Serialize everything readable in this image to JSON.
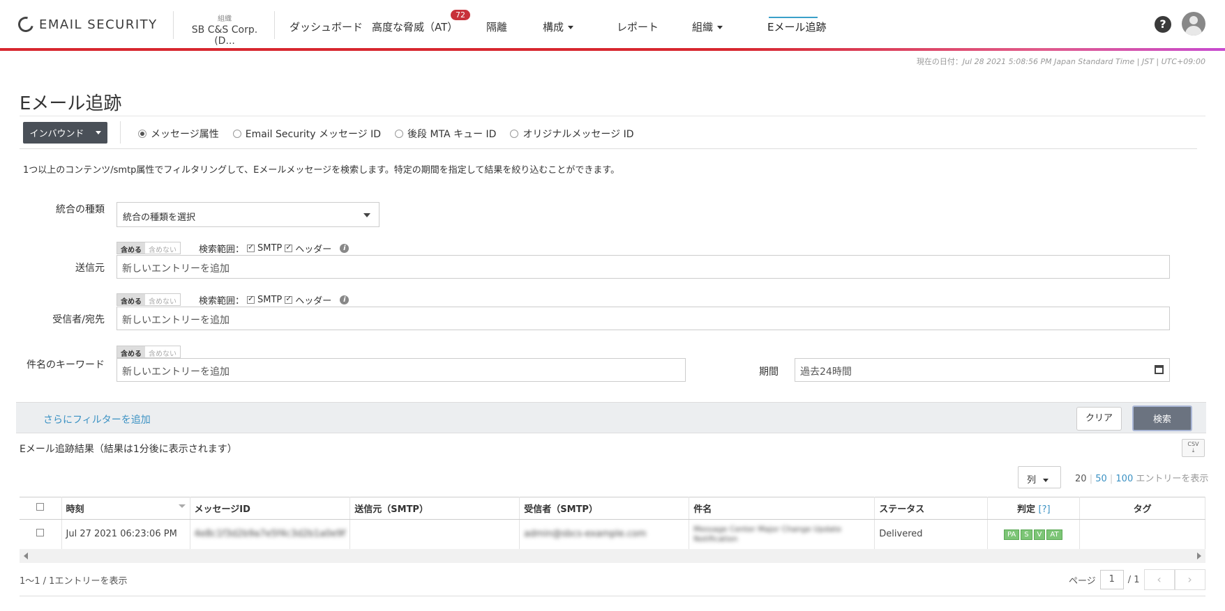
{
  "header": {
    "logo_text": "EMAIL SECURITY",
    "org_label": "組織",
    "org_name": "SB C&S Corp. (D...",
    "nav": {
      "dashboard": "ダッシュボード",
      "advanced_threats": "高度な脅威（AT）",
      "advanced_threats_badge": "72",
      "quarantine": "隔離",
      "config": "構成",
      "reports": "レポート",
      "organization": "組織",
      "email_trace": "Eメール追跡"
    },
    "help_icon": "question-circle-icon",
    "user_icon": "user-avatar-icon"
  },
  "datetime": {
    "label": "現在の日付：",
    "value": "Jul 28 2021 5:08:56 PM Japan Standard Time | JST | UTC+09:00"
  },
  "page_title": "Eメール追跡",
  "direction_button": "インバウンド",
  "search_modes": [
    {
      "label": "メッセージ属性",
      "selected": true
    },
    {
      "label": "Email Security メッセージ ID",
      "selected": false
    },
    {
      "label": "後段 MTA キュー ID",
      "selected": false
    },
    {
      "label": "オリジナルメッセージ ID",
      "selected": false
    }
  ],
  "description": "1つ以上のコンテンツ/smtp属性でフィルタリングして、Eメールメッセージを検索します。特定の期間を指定して結果を絞り込むことができます。",
  "form": {
    "integration_label": "統合の種類",
    "integration_placeholder": "統合の種類を選択",
    "include": "含める",
    "exclude": "含めない",
    "scope_label": "検索範囲：",
    "smtp": "SMTP",
    "header": "ヘッダー",
    "sender_label": "送信元",
    "recipient_label": "受信者/宛先",
    "subject_label": "件名のキーワード",
    "new_entry": "新しいエントリーを追加",
    "period_label": "期間",
    "period_value": "過去24時間"
  },
  "filter_bar": {
    "add_filter": "さらにフィルターを追加",
    "clear": "クリア",
    "search": "検索"
  },
  "results": {
    "title": "Eメール追跡結果（結果は1分後に表示されます）",
    "csv_label": "CSV",
    "columns_button": "列",
    "page_size_20": "20",
    "page_size_50": "50",
    "page_size_100": "100",
    "page_size_suffix": "エントリーを表示",
    "headers": [
      "時刻",
      "メッセージID",
      "送信元（SMTP）",
      "受信者（SMTP）",
      "件名",
      "ステータス",
      "判定",
      "タグ"
    ],
    "verdict_help": "[?]",
    "rows": [
      {
        "time": "Jul 27 2021 06:23:06 PM",
        "message_id": "4e8c1f3d2b9a7e5f4c3d2b1a0e9f",
        "sender": "",
        "recipient": "admin@sbcs-example.com",
        "subject": "Message Center Major Change Update Notification",
        "status": "Delivered",
        "verdicts": [
          "PA",
          "S",
          "V",
          "AT"
        ],
        "tag": ""
      }
    ],
    "footer_count": "1～1 / 1エントリーを表示",
    "page_label": "ページ",
    "page_current": "1",
    "page_total": "/ 1"
  }
}
